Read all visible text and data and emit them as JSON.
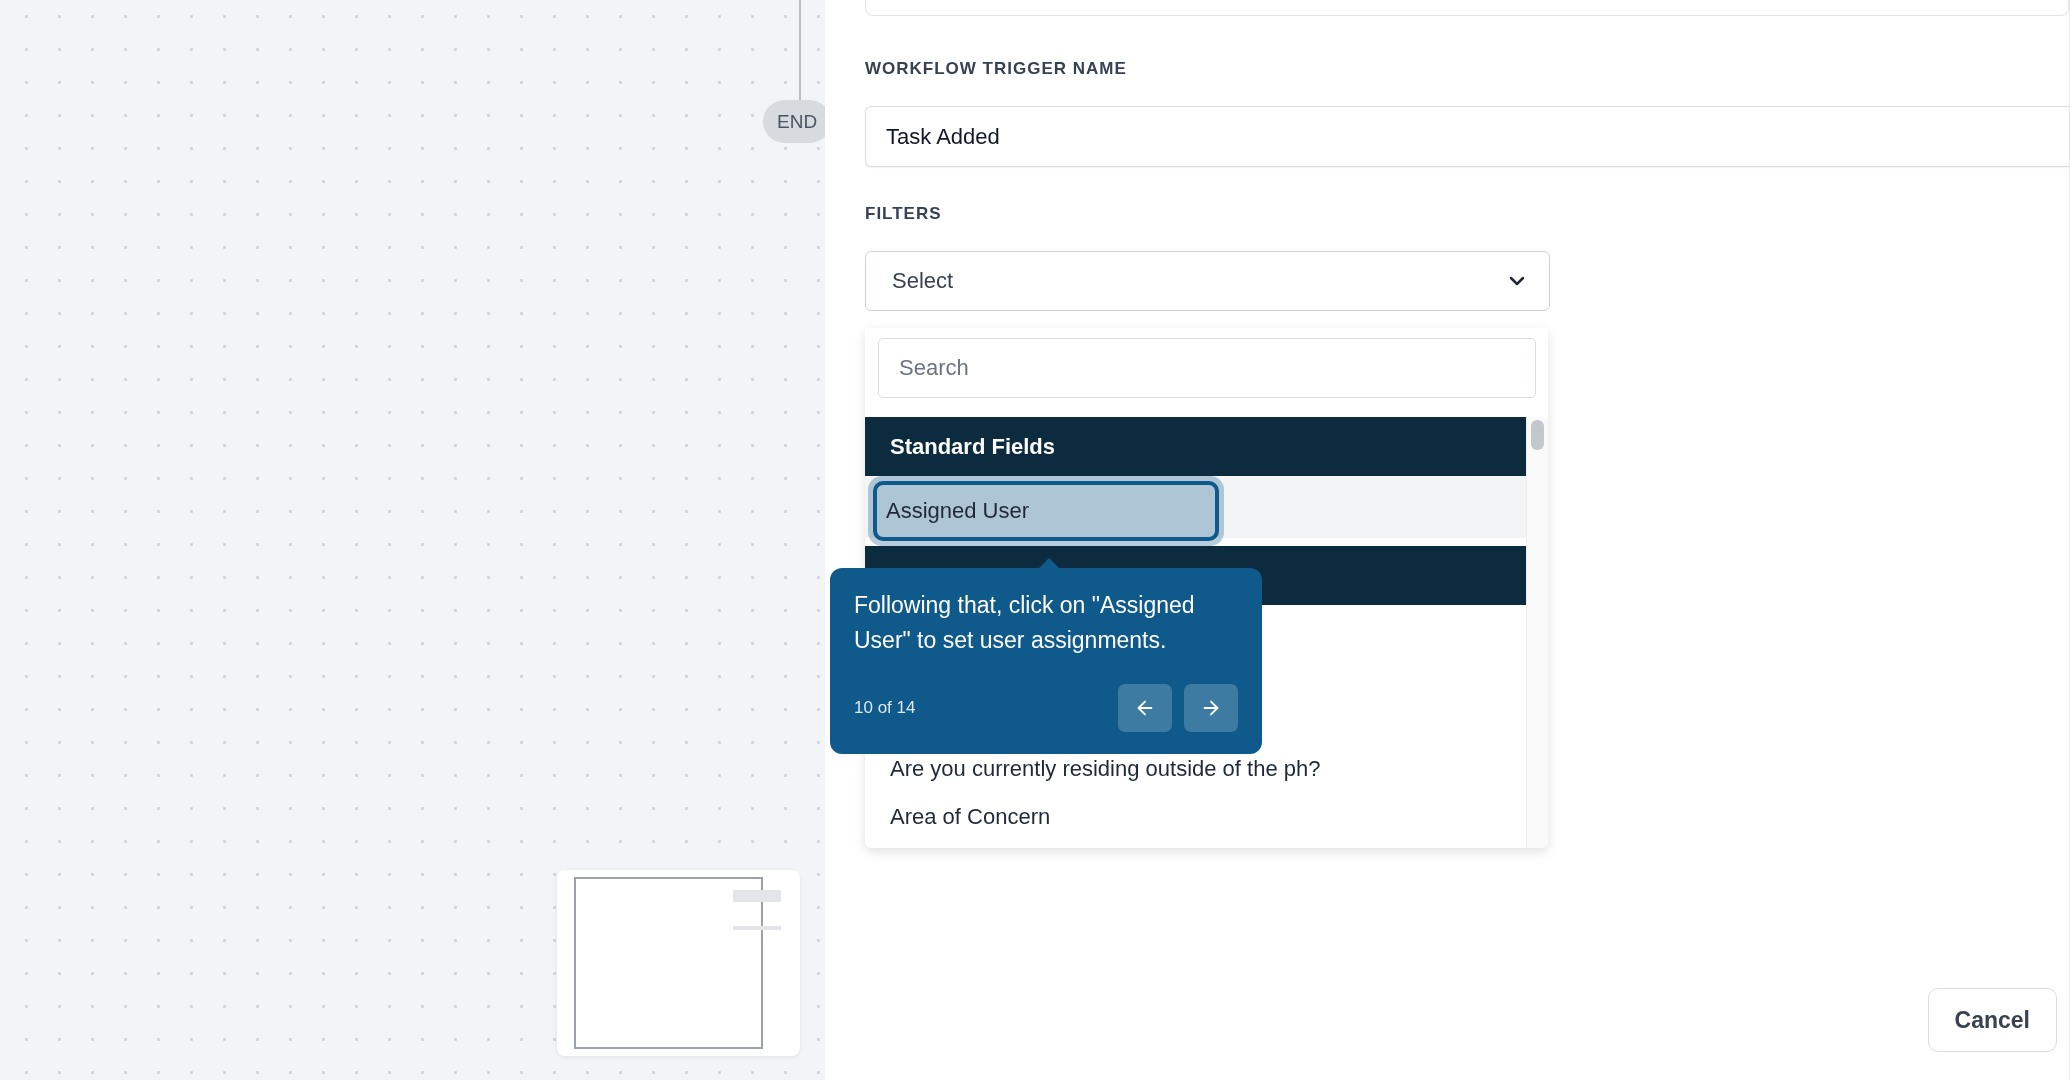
{
  "canvas": {
    "end_node": {
      "label": "END"
    }
  },
  "form": {
    "trigger_name": {
      "label": "WORKFLOW TRIGGER NAME",
      "value": "Task Added"
    },
    "filters": {
      "label": "FILTERS",
      "select": {
        "value": "Select",
        "expanded": true
      },
      "dropdown": {
        "search": {
          "placeholder": "Search"
        },
        "items": [
          {
            "kind": "header",
            "label": "Standard Fields"
          },
          {
            "kind": "option",
            "label": "Assigned User",
            "highlighted": true
          },
          {
            "kind": "header"
          },
          {
            "kind": "covered"
          },
          {
            "kind": "covered"
          },
          {
            "kind": "option",
            "label": "Are you currently residing outside of the ph?",
            "highlighted": false
          },
          {
            "kind": "option",
            "label": "Area of Concern",
            "highlighted": false
          }
        ]
      }
    }
  },
  "tour_tooltip": {
    "text": "Following that, click on \"Assigned User\" to set user assignments.",
    "step": "10 of 14"
  },
  "footer": {
    "buttons": [
      "Cancel"
    ]
  }
}
